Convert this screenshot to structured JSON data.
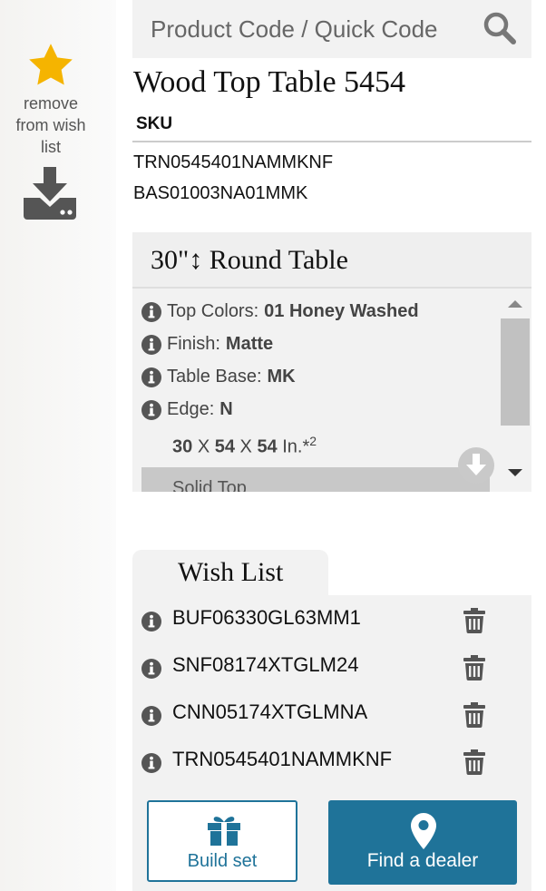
{
  "wishlist_action": {
    "label": "remove from wish list",
    "icon": "star-icon"
  },
  "download": {
    "icon": "download-icon"
  },
  "search": {
    "placeholder": "Product Code / Quick Code",
    "icon": "search-icon"
  },
  "product": {
    "title": "Wood Top Table 5454",
    "sku_label": "SKU",
    "skus": [
      "TRN0545401NAMMKNF",
      "BAS01003NA01MMK"
    ]
  },
  "config": {
    "title": "30\"↕ Round Table",
    "options": [
      {
        "label": "Top Colors:",
        "value": "01 Honey Washed"
      },
      {
        "label": "Finish:",
        "value": "Matte"
      },
      {
        "label": "Table Base:",
        "value": "MK"
      },
      {
        "label": "Edge:",
        "value": "N"
      }
    ],
    "dims": {
      "w": "30",
      "d": "54",
      "h": "54",
      "sep": "X",
      "unit": "In.*",
      "note": "2"
    },
    "solid_top": "Solid Top"
  },
  "wish_list": {
    "tab_label": "Wish List",
    "items": [
      "BUF06330GL63MM1",
      "SNF08174XTGLM24",
      "CNN05174XTGLMNA",
      "TRN0545401NAMMKNF"
    ]
  },
  "buttons": {
    "build_set": "Build set",
    "find_dealer": "Find a dealer"
  },
  "colors": {
    "accent": "#1f7399",
    "star": "#f5b400",
    "panel": "#f2f2f2"
  }
}
